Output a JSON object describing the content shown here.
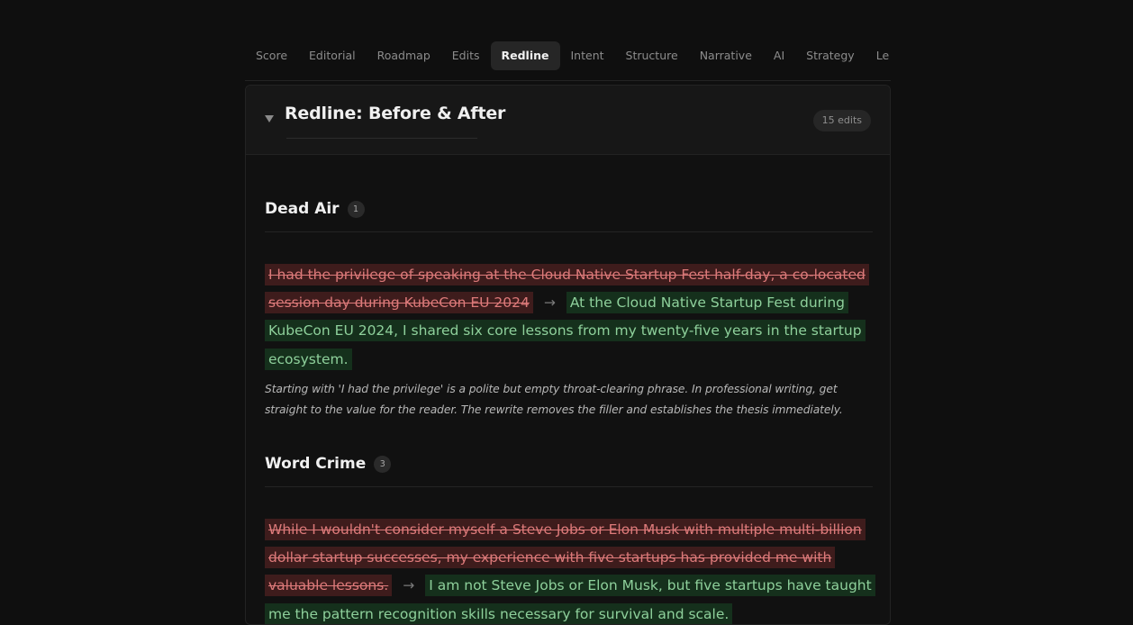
{
  "tabs": [
    "Score",
    "Editorial",
    "Roadmap",
    "Edits",
    "Redline",
    "Intent",
    "Structure",
    "Narrative",
    "AI",
    "Strategy",
    "Le"
  ],
  "active_tab": "Redline",
  "panel": {
    "title": "Redline: Before & After",
    "badge": "15 edits"
  },
  "sections": [
    {
      "title": "Dead Air",
      "count": "1",
      "deleted": "I had the privilege of speaking at the Cloud Native Startup Fest half-day, a co-located session day during KubeCon EU 2024",
      "arrow": "→",
      "inserted": "At the Cloud Native Startup Fest during KubeCon EU 2024, I shared six core lessons from my twenty-five years in the startup ecosystem.",
      "explanation": "Starting with 'I had the privilege' is a polite but empty throat-clearing phrase. In professional writing, get straight to the value for the reader. The rewrite removes the filler and establishes the thesis immediately."
    },
    {
      "title": "Word Crime",
      "count": "3",
      "deleted": "While I wouldn't consider myself a Steve Jobs or Elon Musk with multiple multi-billion dollar startup successes, my experience with five startups has provided me with valuable lessons.",
      "arrow": "→",
      "inserted": "I am not Steve Jobs or Elon Musk, but five startups have taught me the pattern recognition skills necessary for survival and scale."
    }
  ],
  "icons": {
    "collapse": "caret-down-icon"
  }
}
